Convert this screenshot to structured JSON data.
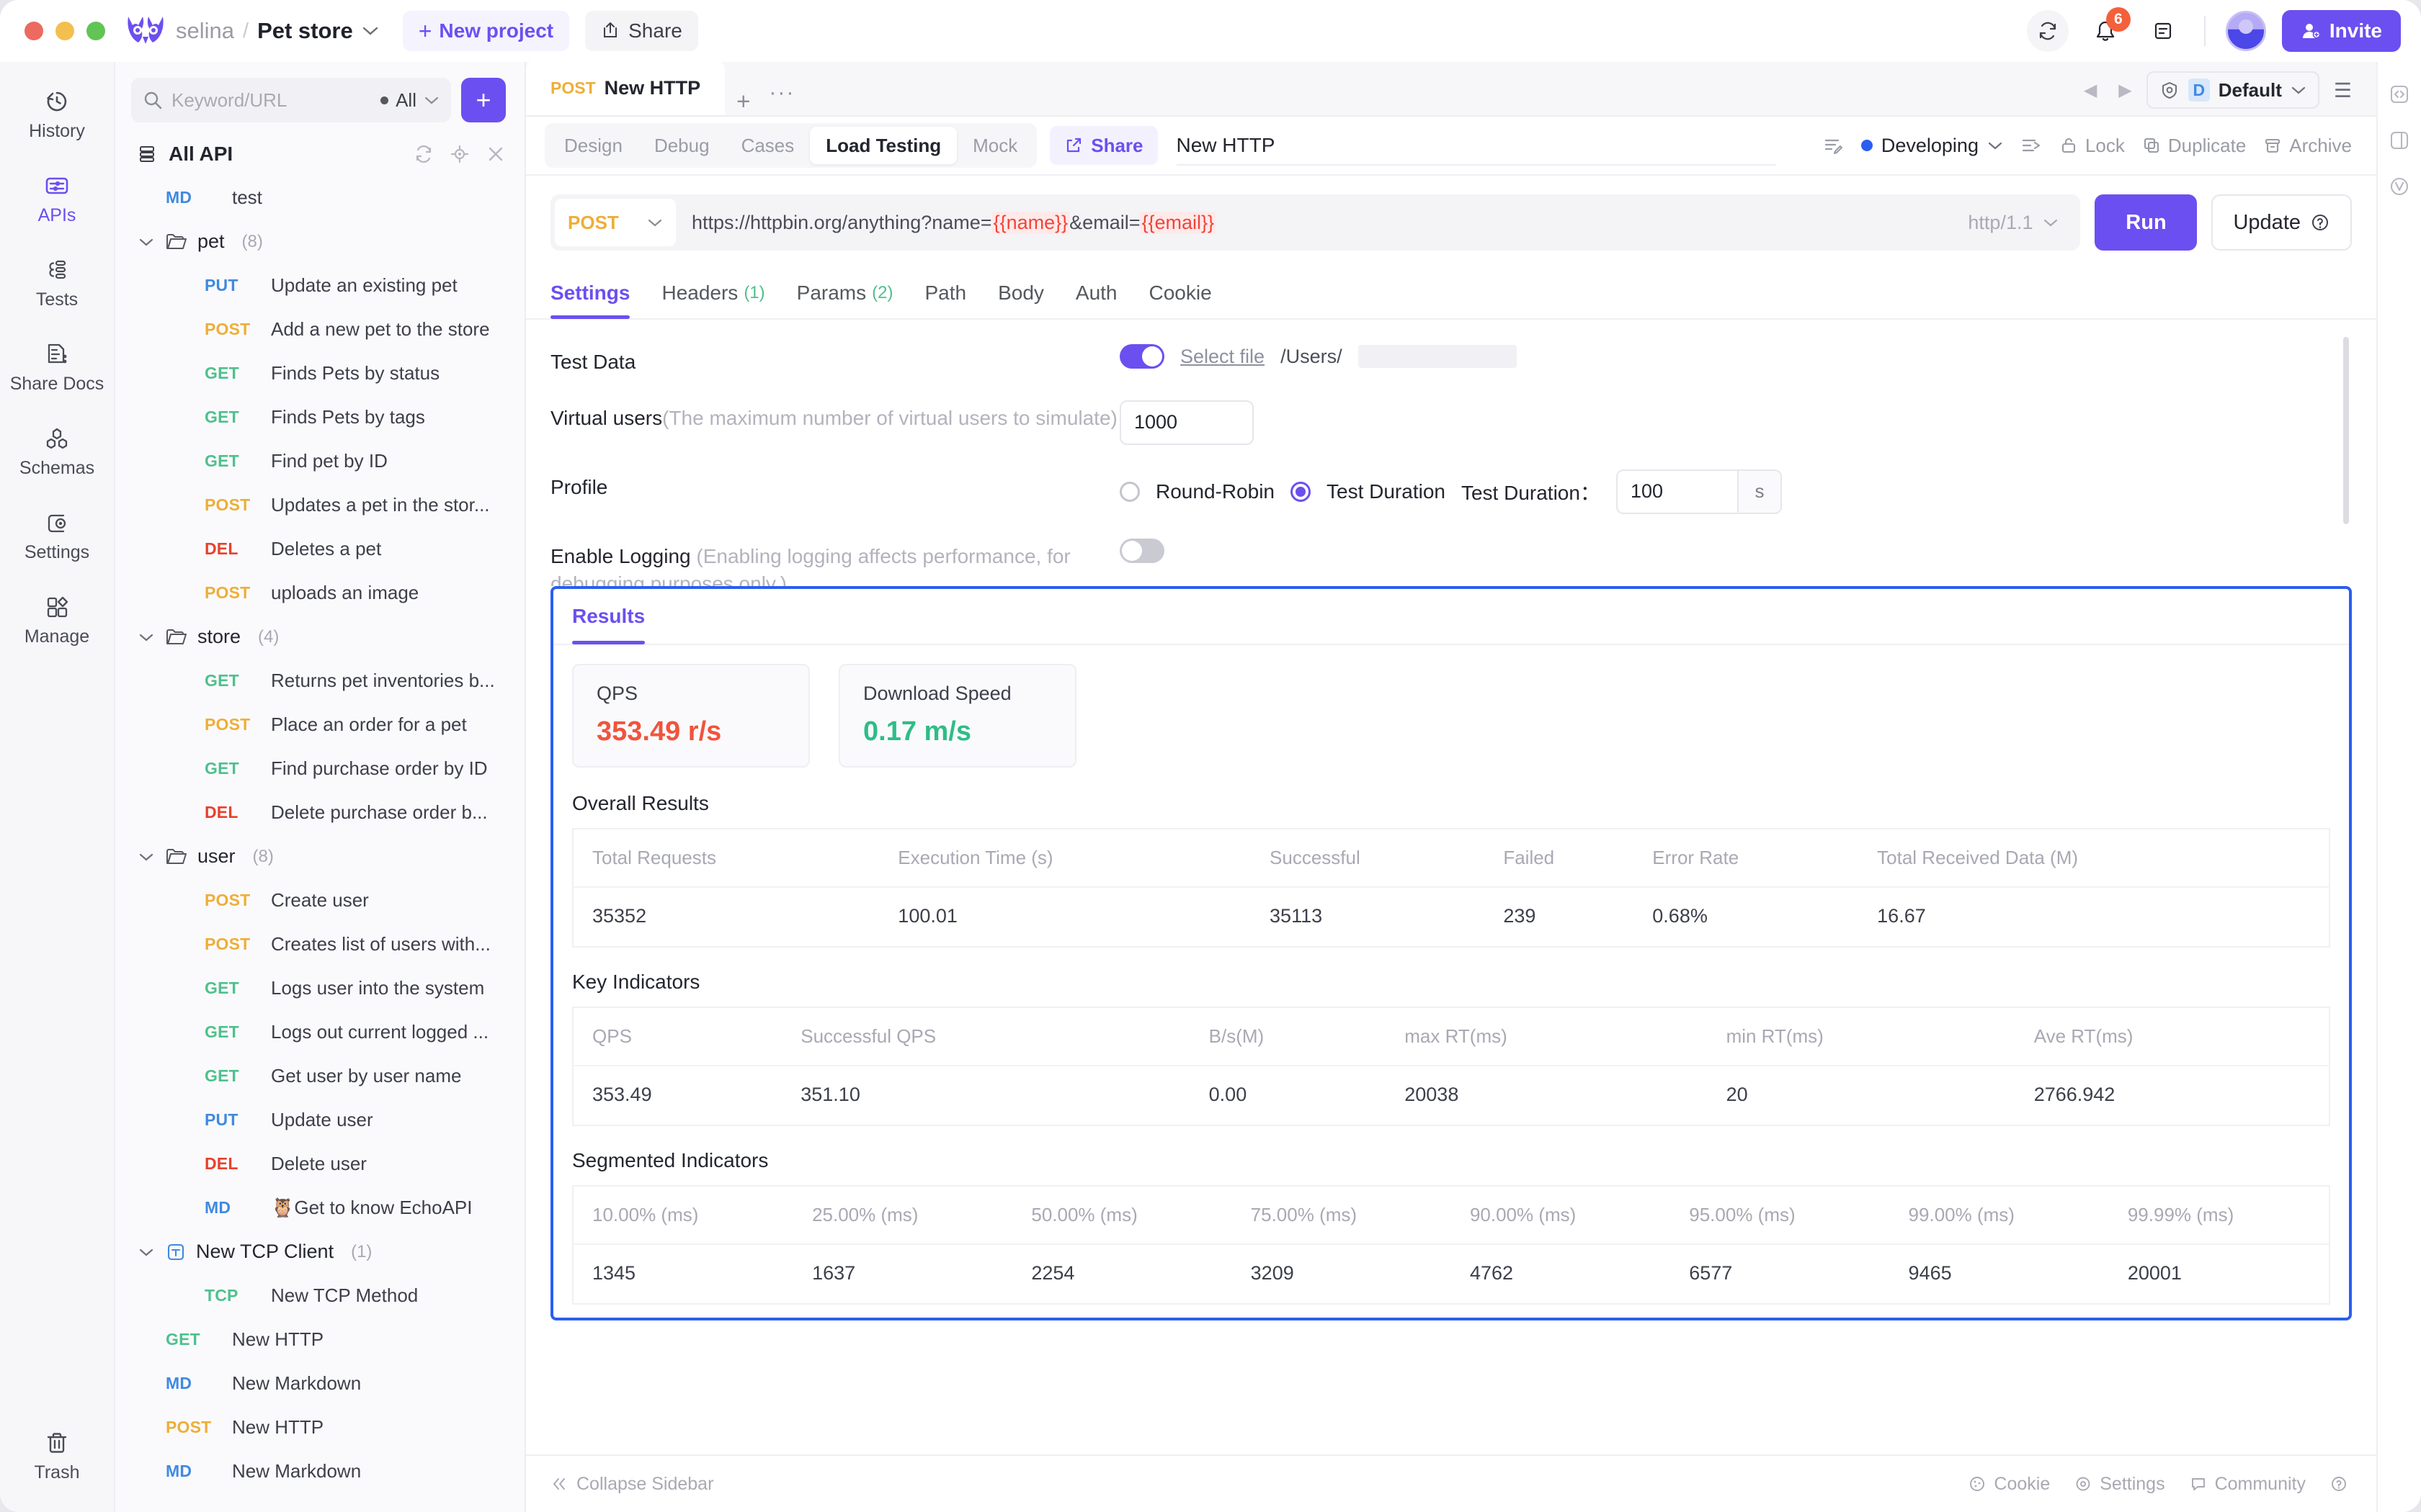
{
  "titlebar": {
    "workspace": "selina",
    "separator": "/",
    "project": "Pet store",
    "new_project_label": "New project",
    "new_project_plus": "+",
    "share_label": "Share",
    "notification_count": "6",
    "invite_label": "Invite"
  },
  "rail": {
    "items": [
      {
        "label": "History",
        "icon": "history-icon",
        "active": false
      },
      {
        "label": "APIs",
        "icon": "apis-icon",
        "active": true
      },
      {
        "label": "Tests",
        "icon": "tests-icon",
        "active": false
      },
      {
        "label": "Share Docs",
        "icon": "share-docs-icon",
        "active": false
      },
      {
        "label": "Schemas",
        "icon": "schemas-icon",
        "active": false
      },
      {
        "label": "Settings",
        "icon": "settings-icon",
        "active": false
      },
      {
        "label": "Manage",
        "icon": "manage-icon",
        "active": false
      }
    ],
    "trash_label": "Trash"
  },
  "tree": {
    "search_placeholder": "Keyword/URL",
    "filter_label": "All",
    "add_label": "+",
    "root_label": "All API",
    "items": [
      {
        "level": 1,
        "kind": "leaf",
        "method": "MD",
        "label": "test"
      },
      {
        "level": 1,
        "kind": "folder",
        "label": "pet",
        "count": "(8)"
      },
      {
        "level": 2,
        "kind": "leaf",
        "method": "PUT",
        "label": "Update an existing pet"
      },
      {
        "level": 2,
        "kind": "leaf",
        "method": "POST",
        "label": "Add a new pet to the store"
      },
      {
        "level": 2,
        "kind": "leaf",
        "method": "GET",
        "label": "Finds Pets by status"
      },
      {
        "level": 2,
        "kind": "leaf",
        "method": "GET",
        "label": "Finds Pets by tags"
      },
      {
        "level": 2,
        "kind": "leaf",
        "method": "GET",
        "label": "Find pet by ID"
      },
      {
        "level": 2,
        "kind": "leaf",
        "method": "POST",
        "label": "Updates a pet in the stor..."
      },
      {
        "level": 2,
        "kind": "leaf",
        "method": "DEL",
        "label": "Deletes a pet"
      },
      {
        "level": 2,
        "kind": "leaf",
        "method": "POST",
        "label": "uploads an image"
      },
      {
        "level": 1,
        "kind": "folder",
        "label": "store",
        "count": "(4)"
      },
      {
        "level": 2,
        "kind": "leaf",
        "method": "GET",
        "label": "Returns pet inventories b..."
      },
      {
        "level": 2,
        "kind": "leaf",
        "method": "POST",
        "label": "Place an order for a pet"
      },
      {
        "level": 2,
        "kind": "leaf",
        "method": "GET",
        "label": "Find purchase order by ID"
      },
      {
        "level": 2,
        "kind": "leaf",
        "method": "DEL",
        "label": "Delete purchase order b..."
      },
      {
        "level": 1,
        "kind": "folder",
        "label": "user",
        "count": "(8)"
      },
      {
        "level": 2,
        "kind": "leaf",
        "method": "POST",
        "label": "Create user"
      },
      {
        "level": 2,
        "kind": "leaf",
        "method": "POST",
        "label": "Creates list of users with..."
      },
      {
        "level": 2,
        "kind": "leaf",
        "method": "GET",
        "label": "Logs user into the system"
      },
      {
        "level": 2,
        "kind": "leaf",
        "method": "GET",
        "label": "Logs out current logged ..."
      },
      {
        "level": 2,
        "kind": "leaf",
        "method": "GET",
        "label": "Get user by user name"
      },
      {
        "level": 2,
        "kind": "leaf",
        "method": "PUT",
        "label": "Update user"
      },
      {
        "level": 2,
        "kind": "leaf",
        "method": "DEL",
        "label": "Delete user"
      },
      {
        "level": 2,
        "kind": "leaf",
        "method": "MD",
        "label": "🦉Get to know EchoAPI"
      },
      {
        "level": 1,
        "kind": "client",
        "label": "New TCP Client",
        "count": "(1)"
      },
      {
        "level": 2,
        "kind": "leaf",
        "method": "TCP",
        "label": "New TCP Method"
      },
      {
        "level": 1,
        "kind": "leaf",
        "method": "GET",
        "label": "New HTTP"
      },
      {
        "level": 1,
        "kind": "leaf",
        "method": "MD",
        "label": "New Markdown"
      },
      {
        "level": 1,
        "kind": "leaf",
        "method": "POST",
        "label": "New HTTP"
      },
      {
        "level": 1,
        "kind": "leaf",
        "method": "MD",
        "label": "New Markdown"
      }
    ]
  },
  "tabstrip": {
    "doc_tab_method": "POST",
    "doc_tab_name": "New HTTP",
    "plus": "+",
    "more": "···",
    "env_letter": "D",
    "env_name": "Default"
  },
  "subbar": {
    "segments": [
      {
        "label": "Design",
        "active": false
      },
      {
        "label": "Debug",
        "active": false
      },
      {
        "label": "Cases",
        "active": false
      },
      {
        "label": "Load Testing",
        "active": true
      },
      {
        "label": "Mock",
        "active": false
      }
    ],
    "share_label": "Share",
    "request_name": "New HTTP",
    "status_label": "Developing",
    "lock_label": "Lock",
    "duplicate_label": "Duplicate",
    "archive_label": "Archive"
  },
  "urlrow": {
    "method": "POST",
    "url_prefix": "https://httpbin.org/anything?name=",
    "var1": "{{name}}",
    "url_mid": "&email=",
    "var2": "{{email}}",
    "http_version": "http/1.1",
    "run_label": "Run",
    "update_label": "Update"
  },
  "request_tabs": [
    {
      "label": "Settings",
      "count": "",
      "active": true
    },
    {
      "label": "Headers",
      "count": "(1)",
      "active": false
    },
    {
      "label": "Params",
      "count": "(2)",
      "active": false
    },
    {
      "label": "Path",
      "count": "",
      "active": false
    },
    {
      "label": "Body",
      "count": "",
      "active": false
    },
    {
      "label": "Auth",
      "count": "",
      "active": false
    },
    {
      "label": "Cookie",
      "count": "",
      "active": false
    }
  ],
  "settings": {
    "test_data_label": "Test Data",
    "test_data_enabled": true,
    "select_file_label": "Select file",
    "file_path": "/Users/",
    "virtual_users_label": "Virtual users",
    "virtual_users_hint": "(The maximum number of virtual users to simulate)",
    "virtual_users_value": "1000",
    "profile_label": "Profile",
    "profile_round_robin": "Round-Robin",
    "profile_test_duration": "Test Duration",
    "test_duration_label": "Test Duration：",
    "test_duration_value": "100",
    "test_duration_unit": "s",
    "enable_logging_label": "Enable Logging",
    "enable_logging_hint": "(Enabling logging affects performance, for debugging purposes only.)",
    "enable_logging_enabled": false
  },
  "results": {
    "tab_label": "Results",
    "cards": [
      {
        "title": "QPS",
        "value": "353.49 r/s",
        "color": "#f0543c"
      },
      {
        "title": "Download Speed",
        "value": "0.17 m/s",
        "color": "#2ebd87"
      }
    ],
    "overall": {
      "title": "Overall Results",
      "headers": [
        "Total Requests",
        "Execution Time (s)",
        "Successful",
        "Failed",
        "Error Rate",
        "Total Received Data (M)"
      ],
      "row": [
        "35352",
        "100.01",
        "35113",
        "239",
        "0.68%",
        "16.67"
      ]
    },
    "key_indicators": {
      "title": "Key Indicators",
      "headers": [
        "QPS",
        "Successful QPS",
        "B/s(M)",
        "max RT(ms)",
        "min RT(ms)",
        "Ave RT(ms)"
      ],
      "row": [
        "353.49",
        "351.10",
        "0.00",
        "20038",
        "20",
        "2766.942"
      ]
    },
    "segmented": {
      "title": "Segmented Indicators",
      "headers": [
        {
          "pct": "10.00%",
          "unit": "(ms)"
        },
        {
          "pct": "25.00%",
          "unit": "(ms)"
        },
        {
          "pct": "50.00%",
          "unit": "(ms)"
        },
        {
          "pct": "75.00%",
          "unit": "(ms)"
        },
        {
          "pct": "90.00%",
          "unit": "(ms)"
        },
        {
          "pct": "95.00%",
          "unit": "(ms)"
        },
        {
          "pct": "99.00%",
          "unit": "(ms)"
        },
        {
          "pct": "99.99%",
          "unit": "(ms)"
        }
      ],
      "row": [
        "1345",
        "1637",
        "2254",
        "3209",
        "4762",
        "6577",
        "9465",
        "20001"
      ]
    }
  },
  "footer": {
    "collapse_label": "Collapse Sidebar",
    "cookie_label": "Cookie",
    "settings_label": "Settings",
    "community_label": "Community"
  },
  "colors": {
    "accent": "#6c4ff0",
    "results_border": "#2b5ef0",
    "qps": "#f0543c",
    "download": "#2ebd87",
    "get": "#4fc08d",
    "post": "#eeae38",
    "put": "#3f8ae0",
    "del": "#e8402e"
  }
}
